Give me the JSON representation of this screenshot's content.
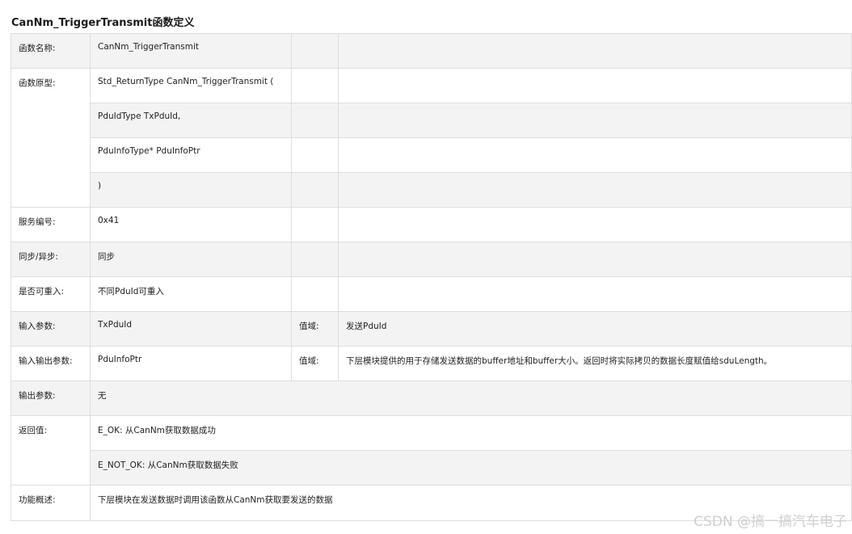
{
  "title": "CanNm_TriggerTransmit函数定义",
  "rows": {
    "name": {
      "label": "函数名称:",
      "value": "CanNm_TriggerTransmit"
    },
    "prototype": {
      "label": "函数原型:",
      "lines": [
        "Std_ReturnType CanNm_TriggerTransmit (",
        "PduIdType TxPduId,",
        "PduInfoType* PduInfoPtr",
        ")"
      ]
    },
    "service_id": {
      "label": "服务编号:",
      "value": "0x41"
    },
    "sync": {
      "label": "同步/异步:",
      "value": "同步"
    },
    "reentrancy": {
      "label": "是否可重入:",
      "value": "不同PduId可重入"
    },
    "params_in": {
      "label": "输入参数:",
      "value": "TxPduId",
      "range_label": "值域:",
      "range_value": "发送PduId"
    },
    "params_inout": {
      "label": "输入输出参数:",
      "value": "PduInfoPtr",
      "range_label": "值域:",
      "range_value": "下层模块提供的用于存储发送数据的buffer地址和buffer大小。返回时将实际拷贝的数据长度赋值给sduLength。"
    },
    "params_out": {
      "label": "输出参数:",
      "value": "无"
    },
    "return": {
      "label": "返回值:",
      "lines": [
        "E_OK: 从CanNm获取数据成功",
        "E_NOT_OK: 从CanNm获取数据失败"
      ]
    },
    "description": {
      "label": "功能概述:",
      "value": "下层模块在发送数据时调用该函数从CanNm获取要发送的数据"
    }
  },
  "watermark": "CSDN @搞一搞汽车电子"
}
